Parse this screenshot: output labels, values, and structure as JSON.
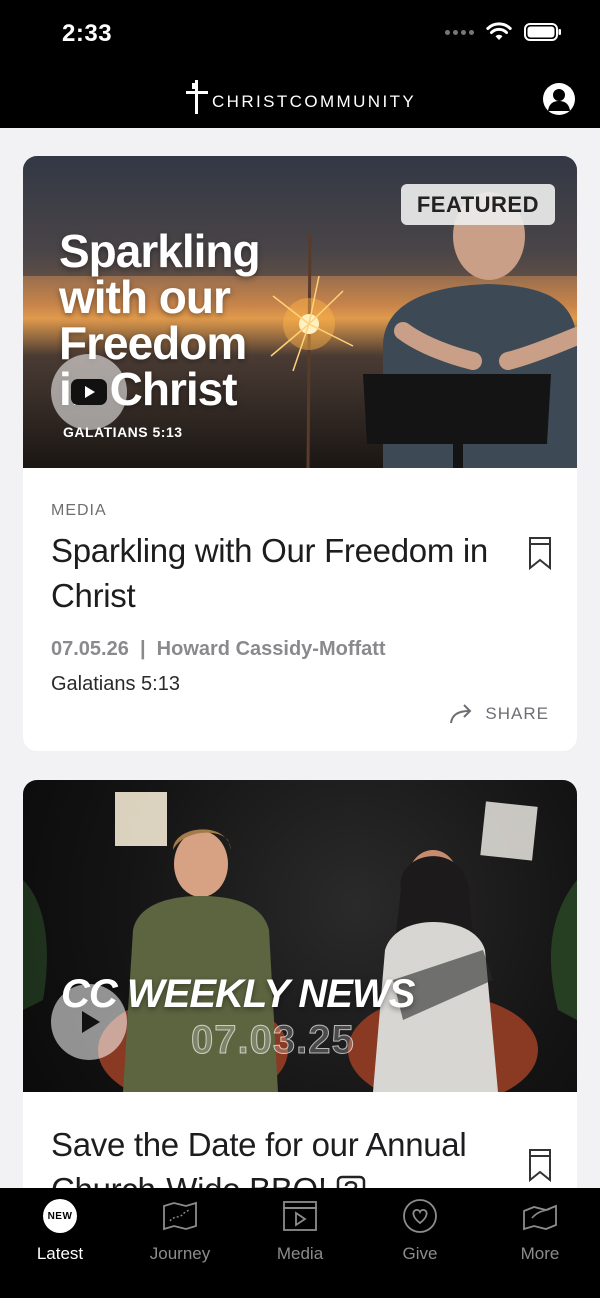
{
  "status_bar": {
    "time": "2:33"
  },
  "header": {
    "logo_text": "CHRISTCOMMUNITY"
  },
  "cards": [
    {
      "badge": "FEATURED",
      "art_title_lines": [
        "Sparkling",
        "with our",
        "Freedom",
        "in Christ"
      ],
      "art_reference": "GALATIANS 5:13",
      "label": "MEDIA",
      "title": "Sparkling with Our Freedom in Christ",
      "meta": "07.05.26  |  Howard Cassidy-Moffatt",
      "subtitle": "Galatians 5:13",
      "share_label": "SHARE"
    },
    {
      "art_title": "CC WEEKLY NEWS",
      "art_date": "07.03.25",
      "title": "Save the Date for our Annual Church-Wide BBQ!",
      "title_suffix_icon": "question-mark-icon"
    }
  ],
  "tabs": [
    {
      "label": "Latest",
      "icon": "new-badge",
      "badge_text": "NEW",
      "active": true
    },
    {
      "label": "Journey",
      "icon": "map-icon"
    },
    {
      "label": "Media",
      "icon": "video-player-icon"
    },
    {
      "label": "Give",
      "icon": "heart-circle-icon"
    },
    {
      "label": "More",
      "icon": "more-map-icon"
    }
  ],
  "colors": {
    "background": "#f2f2f4",
    "bars": "#000000",
    "card": "#ffffff",
    "muted_text": "#8a8a8e"
  }
}
